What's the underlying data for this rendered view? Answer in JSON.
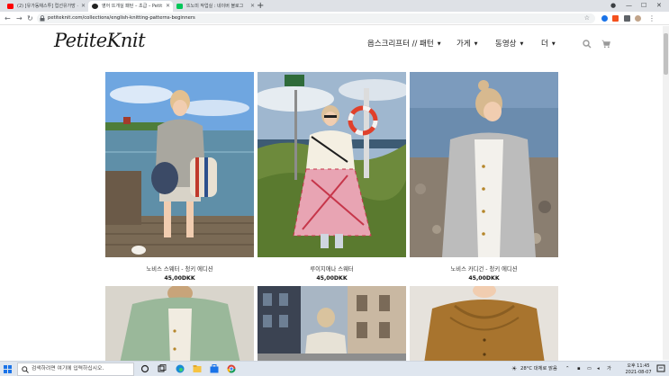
{
  "browser": {
    "tabs": [
      {
        "label": "(2) [유가동채스투] 럽선유가방 · ",
        "favicon_color": "#ff0000",
        "active": false
      },
      {
        "label": "영어 뜨개실 패턴 – 초급 – Petit",
        "favicon_color": "#222222",
        "active": true
      },
      {
        "label": "뜨노미 작업실 : 네이버 블로그",
        "favicon_color": "#03c75a",
        "active": false
      }
    ],
    "url": "petiteknit.com/collections/english-knitting-patterns-beginners"
  },
  "site": {
    "logo": "PetiteKnit",
    "menu": [
      {
        "label": "옵스크리프터 // 패턴"
      },
      {
        "label": "가게"
      },
      {
        "label": "동영상"
      },
      {
        "label": "더"
      }
    ]
  },
  "products": [
    {
      "title": "노비스 스웨터 - 청키 에디션",
      "price": "45,00DKK"
    },
    {
      "title": "루이지애나 스웨터",
      "price": "45,00DKK"
    },
    {
      "title": "노비스 카디건 - 청키 에디션",
      "price": "45,00DKK"
    }
  ],
  "taskbar": {
    "search_placeholder": "검색하려면 여기에 입력하십시오.",
    "weather": "28°C 대체로 맑음",
    "time": "오후 11:45",
    "date": "2021-08-07"
  },
  "colors": {
    "accent": "#1a73e8",
    "taskbar_bg": "#dfe6ef"
  }
}
